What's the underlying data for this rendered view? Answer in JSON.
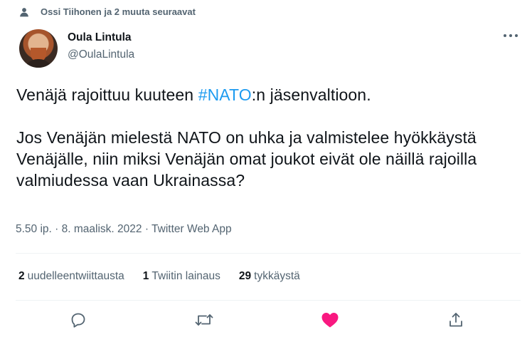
{
  "social_context": {
    "text": "Ossi Tiihonen ja 2 muuta seuraavat",
    "icon": "person-icon"
  },
  "author": {
    "display_name": "Oula Lintula",
    "handle": "@OulaLintula"
  },
  "tweet": {
    "line1_before": "Venäjä rajoittuu kuuteen ",
    "hashtag": "#NATO",
    "line1_after": ":n jäsenvaltioon.",
    "paragraph2": "Jos Venäjän mielestä NATO on uhka ja valmistelee hyökkäystä Venäjälle, niin miksi Venäjän omat joukot eivät ole näillä rajoilla valmiudessa vaan Ukrainassa?"
  },
  "meta": {
    "time": "5.50 ip.",
    "separator": " · ",
    "date": "8. maalisk. 2022",
    "source": "Twitter Web App"
  },
  "stats": {
    "retweets_count": "2",
    "retweets_label": "uudelleentwiittausta",
    "quotes_count": "1",
    "quotes_label": "Twiitin lainaus",
    "likes_count": "29",
    "likes_label": "tykkäystä"
  },
  "actions": {
    "reply_icon": "reply-icon",
    "retweet_icon": "retweet-icon",
    "like_icon": "heart-icon",
    "share_icon": "share-icon",
    "like_color": "#f91880",
    "icon_color": "#536471"
  },
  "colors": {
    "accent": "#1d9bf0",
    "secondary_text": "#536471",
    "primary_text": "#0f1419"
  }
}
